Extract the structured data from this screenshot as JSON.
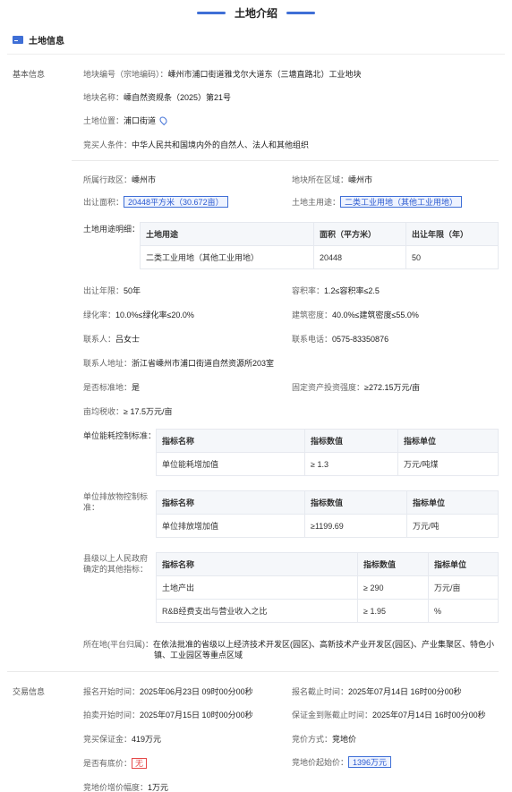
{
  "page": {
    "title": "土地介绍"
  },
  "section": {
    "title": "土地信息"
  },
  "groups": {
    "basic": "基本信息",
    "trade": "交易信息"
  },
  "basic": {
    "parcel_no_label": "地块编号（宗地编码）：",
    "parcel_no_value": "嵊州市浦口街道雅戈尔大道东（三塘直路北）工业地块",
    "parcel_name_label": "地块名称：",
    "parcel_name_value": "嵊自然资规条（2025）第21号",
    "location_label": "土地位置：",
    "location_value": "浦口街道",
    "bidder_label": "竞买人条件：",
    "bidder_value": "中华人民共和国境内外的自然人、法人和其他组织"
  },
  "detail": {
    "district_label": "所属行政区：",
    "district_value": "嵊州市",
    "area_region_label": "地块所在区域：",
    "area_region_value": "嵊州市",
    "sale_area_label": "出让面积：",
    "sale_area_value": "20448平方米（30.672亩）",
    "main_use_label": "土地主用途：",
    "main_use_value": "二类工业用地（其他工业用地）",
    "use_details_label": "土地用途明细：",
    "use_table": {
      "headers": [
        "土地用途",
        "面积（平方米）",
        "出让年限（年）"
      ],
      "rows": [
        [
          "二类工业用地（其他工业用地）",
          "20448",
          "50"
        ]
      ]
    },
    "term_label": "出让年限：",
    "term_value": "50年",
    "far_label": "容积率：",
    "far_value": "1.2≤容积率≤2.5",
    "green_label": "绿化率：",
    "green_value": "10.0%≤绿化率≤20.0%",
    "density_label": "建筑密度：",
    "density_value": "40.0%≤建筑密度≤55.0%",
    "contact_label": "联系人：",
    "contact_value": "吕女士",
    "phone_label": "联系电话：",
    "phone_value": "0575-83350876",
    "address_label": "联系人地址：",
    "address_value": "浙江省嵊州市浦口街道自然资源所203室",
    "standard_label": "是否标准地：",
    "standard_value": "是",
    "invest_label": "固定资产投资强度：",
    "invest_value": "≥272.15万元/亩",
    "tax_label": "亩均税收：",
    "tax_value": "≥ 17.5万元/亩",
    "energy_label": "单位能耗控制标准：",
    "energy_table": {
      "headers": [
        "指标名称",
        "指标数值",
        "指标单位"
      ],
      "rows": [
        [
          "单位能耗增加值",
          "≥ 1.3",
          "万元/吨煤"
        ]
      ]
    },
    "emission_label_1": "单位排放物控制标",
    "emission_label_2": "准：",
    "emission_table": {
      "headers": [
        "指标名称",
        "指标数值",
        "指标单位"
      ],
      "rows": [
        [
          "单位排放增加值",
          "≥1199.69",
          "万元/吨"
        ]
      ]
    },
    "other_label_1": "县级以上人民政府",
    "other_label_2": "确定的其他指标：",
    "other_table": {
      "headers": [
        "指标名称",
        "指标数值",
        "指标单位"
      ],
      "rows": [
        [
          "土地产出",
          "≥ 290",
          "万元/亩"
        ],
        [
          "R&B经费支出与营业收入之比",
          "≥ 1.95",
          "%"
        ]
      ]
    },
    "platform_label": "所在地(平台归属)：",
    "platform_value_1": "在依法批准的省级以上经济技术开发区(园区)、高新技术产业开发区(园区)、产业集聚区、特色小",
    "platform_value_2": "镇、工业园区等重点区域"
  },
  "trade": {
    "signup_start_label": "报名开始时间：",
    "signup_start_value": "2025年06月23日 09时00分00秒",
    "signup_end_label": "报名截止时间：",
    "signup_end_value": "2025年07月14日 16时00分00秒",
    "auction_start_label": "拍卖开始时间：",
    "auction_start_value": "2025年07月15日 10时00分00秒",
    "deposit_deadline_label": "保证金到账截止时间：",
    "deposit_deadline_value": "2025年07月14日 16时00分00秒",
    "deposit_label": "竞买保证金：",
    "deposit_value": "419万元",
    "method_label": "竞价方式：",
    "method_value": "竞地价",
    "reserve_label": "是否有底价：",
    "reserve_value": "无",
    "start_price_label": "竞地价起始价：",
    "start_price_value": "1396万元",
    "increment_label": "竞地价增价幅度：",
    "increment_value": "1万元"
  },
  "colors": {
    "accent": "#3f6fd6",
    "alert": "#e54848"
  },
  "icons": {
    "section": "land-info-icon",
    "location": "location-pin-icon"
  }
}
